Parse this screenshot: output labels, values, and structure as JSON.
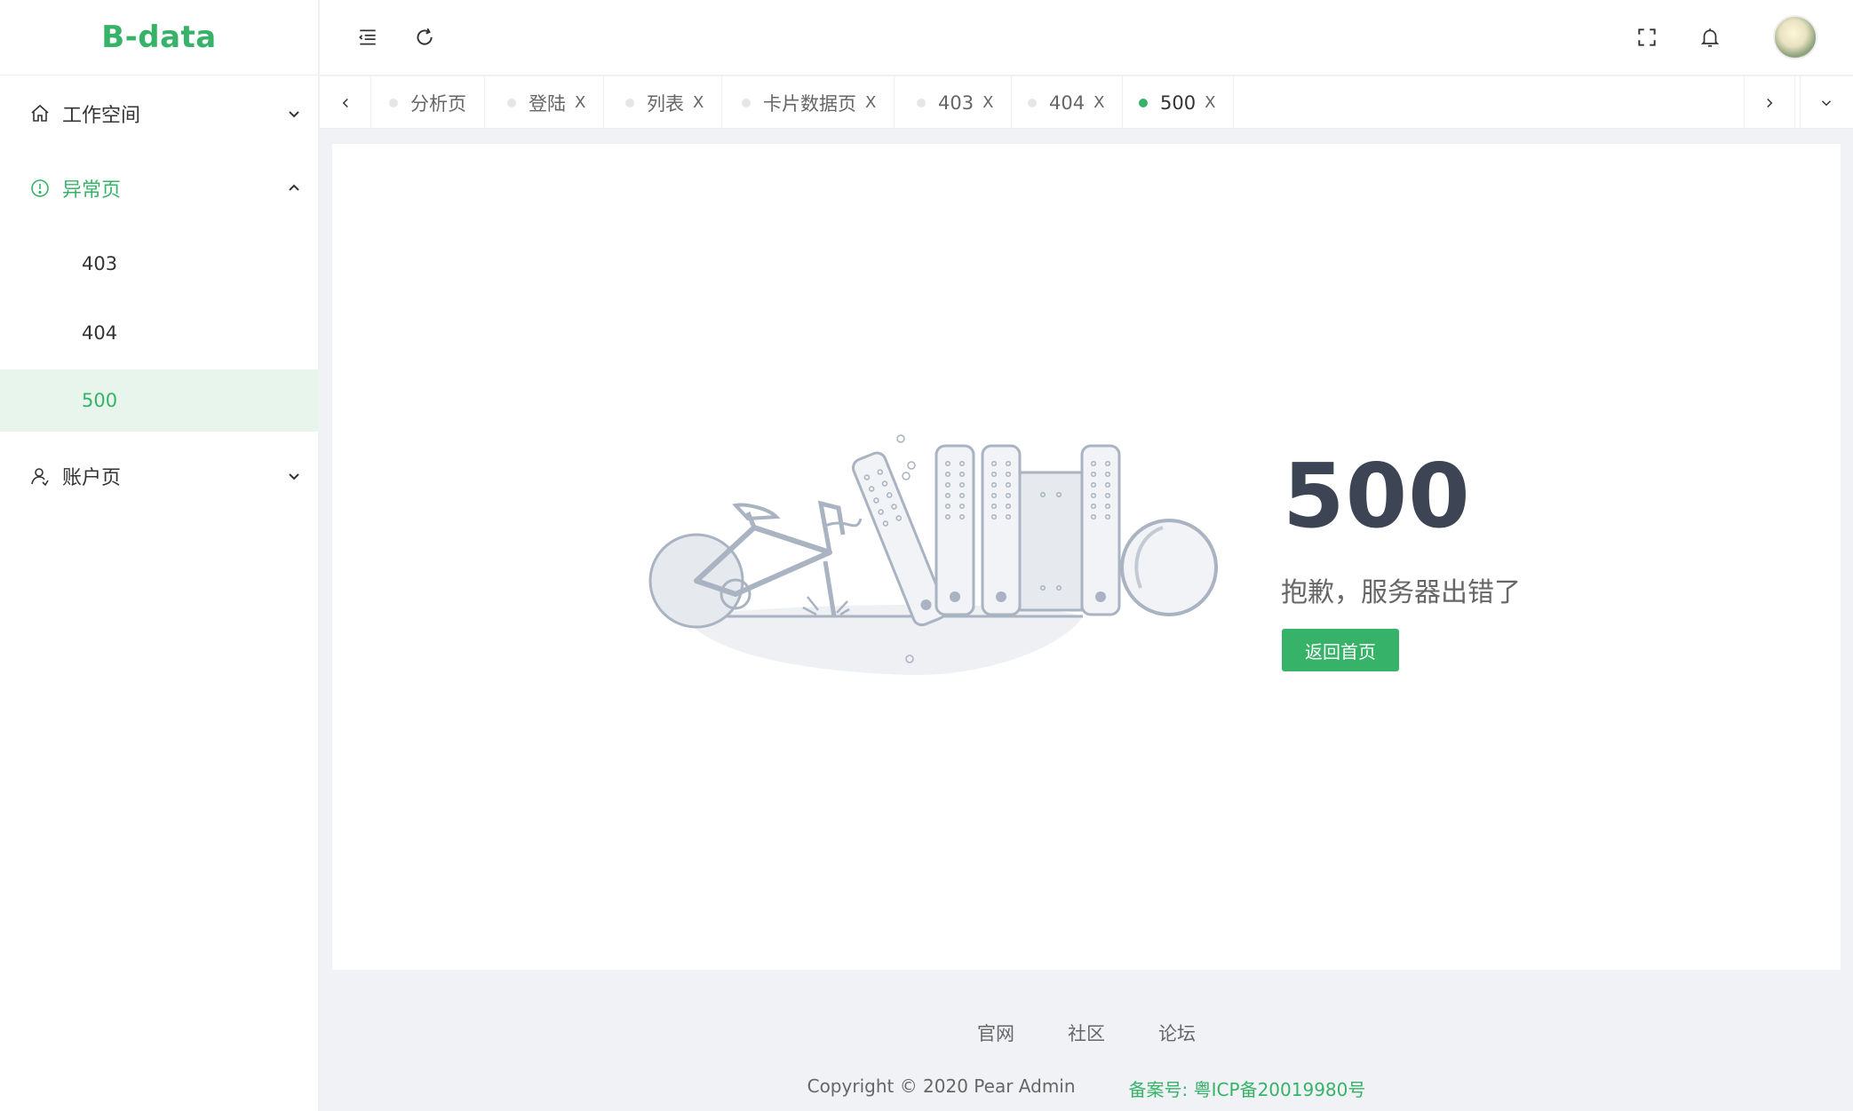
{
  "app": {
    "logo": "B-data"
  },
  "sidebar": {
    "groups": [
      {
        "label": "工作空间",
        "icon": "home-icon",
        "expanded": false
      },
      {
        "label": "异常页",
        "icon": "alert-circle-icon",
        "expanded": true,
        "children": [
          {
            "label": "403"
          },
          {
            "label": "404"
          },
          {
            "label": "500",
            "selected": true
          }
        ]
      },
      {
        "label": "账户页",
        "icon": "user-icon",
        "expanded": false
      }
    ]
  },
  "header": {
    "buttons": [
      "menu-fold-icon",
      "refresh-icon",
      "fullscreen-icon",
      "bell-icon"
    ]
  },
  "tabs": [
    {
      "label": "分析页",
      "closable": false
    },
    {
      "label": "登陆",
      "closable": true
    },
    {
      "label": "列表",
      "closable": true
    },
    {
      "label": "卡片数据页",
      "closable": true
    },
    {
      "label": "403",
      "closable": true
    },
    {
      "label": "404",
      "closable": true
    },
    {
      "label": "500",
      "closable": true,
      "active": true
    }
  ],
  "tab_close_glyph": "X",
  "error": {
    "code": "500",
    "message": "抱歉，服务器出错了",
    "button": "返回首页"
  },
  "footer": {
    "links": [
      "官网",
      "社区",
      "论坛"
    ],
    "copyright": "Copyright © 2020 Pear Admin",
    "icp": "备案号: 粤ICP备20019980号"
  },
  "colors": {
    "accent": "#36b368",
    "text": "#333333",
    "code": "#3d4554"
  }
}
